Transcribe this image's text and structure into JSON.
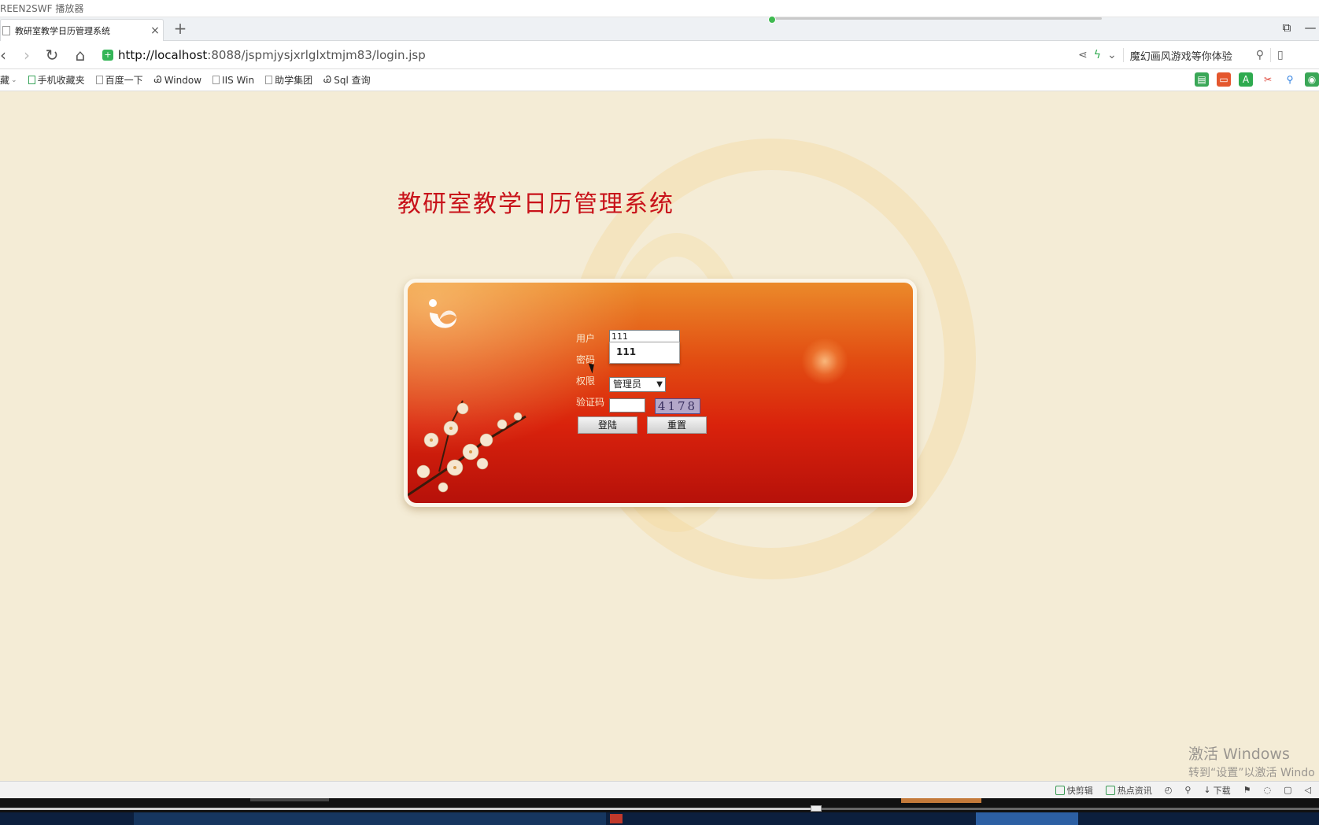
{
  "app_title": "REEN2SWF 播放器",
  "tab": {
    "label": "教研室教学日历管理系统",
    "close": "×",
    "new_tab": "+"
  },
  "address_bar": {
    "url_host": "http://localhost",
    "url_rest": ":8088/jspmjysjxrlglxtmjm83/login.jsp",
    "search_text": "魔幻画风游戏等你体验"
  },
  "bookmarks": [
    {
      "label": "藏"
    },
    {
      "label": "手机收藏夹"
    },
    {
      "label": "百度一下"
    },
    {
      "label": "Window"
    },
    {
      "label": "IIS Win"
    },
    {
      "label": "助学集团"
    },
    {
      "label": "Sql 查询"
    }
  ],
  "page": {
    "system_title": "教研室教学日历管理系统",
    "labels": {
      "user": "用户",
      "password": "密码",
      "role": "权限",
      "captcha": "验证码"
    },
    "user_value": "111",
    "autocomplete_option": "111",
    "password_value": "",
    "role_selected": "管理员",
    "captcha_input": "",
    "captcha_code": "4178",
    "login_button": "登陆",
    "reset_button": "重置"
  },
  "watermark": {
    "line1": "激活 Windows",
    "line2": "转到“设置”以激活 Windo"
  },
  "statusbar": {
    "items": [
      "快剪辑",
      "热点资讯",
      "下载"
    ]
  },
  "taskbar": {
    "task_label": ""
  },
  "colors": {
    "title_red": "#c8121a",
    "page_bg": "#f4ecd6",
    "card_top": "#eb8a2a",
    "card_bottom": "#b6110a"
  }
}
